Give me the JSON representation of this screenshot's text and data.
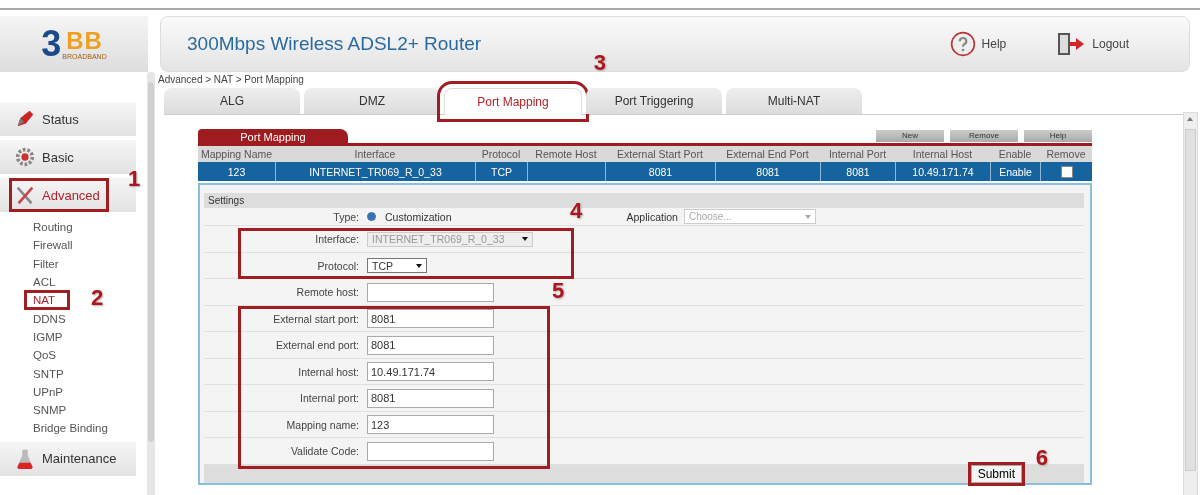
{
  "logo": {
    "digit": "3",
    "letters": "BB",
    "tagline": "BROADBAND"
  },
  "header": {
    "title": "300Mbps Wireless ADSL2+ Router",
    "actions": [
      {
        "label": "Help",
        "kind": "help"
      },
      {
        "label": "Logout",
        "kind": "logout"
      }
    ]
  },
  "sidebar": {
    "sections": [
      {
        "label": "Status",
        "kind": "status",
        "selected": false
      },
      {
        "label": "Basic",
        "kind": "basic",
        "selected": false
      },
      {
        "label": "Advanced",
        "kind": "advanced",
        "selected": true,
        "annotation": "1",
        "children": [
          {
            "label": "Routing",
            "selected": false
          },
          {
            "label": "Firewall",
            "selected": false
          },
          {
            "label": "Filter",
            "selected": false
          },
          {
            "label": "ACL",
            "selected": false
          },
          {
            "label": "NAT",
            "selected": true,
            "annotation": "2"
          },
          {
            "label": "DDNS",
            "selected": false
          },
          {
            "label": "IGMP",
            "selected": false
          },
          {
            "label": "QoS",
            "selected": false
          },
          {
            "label": "SNTP",
            "selected": false
          },
          {
            "label": "UPnP",
            "selected": false
          },
          {
            "label": "SNMP",
            "selected": false
          },
          {
            "label": "Bridge Binding",
            "selected": false
          }
        ]
      },
      {
        "label": "Maintenance",
        "kind": "maintenance",
        "selected": false
      }
    ]
  },
  "breadcrumb": "Advanced > NAT > Port Mapping",
  "tabs": [
    {
      "label": "ALG",
      "selected": false
    },
    {
      "label": "DMZ",
      "selected": false
    },
    {
      "label": "Port Mapping",
      "selected": true,
      "annotation": "3"
    },
    {
      "label": "Port Triggering",
      "selected": false
    },
    {
      "label": "Multi-NAT",
      "selected": false
    }
  ],
  "panel": {
    "title": "Port Mapping",
    "buttons": [
      "New",
      "Remove",
      "Help"
    ],
    "table": {
      "columns": [
        "Mapping Name",
        "Interface",
        "Protocol",
        "Remote Host",
        "External Start Port",
        "External End Port",
        "Internal Port",
        "Internal Host",
        "Enable",
        "Remove"
      ],
      "rows": [
        {
          "selected": true,
          "cells": [
            "123",
            "INTERNET_TR069_R_0_33",
            "TCP",
            "",
            "8081",
            "8081",
            "8081",
            "10.49.171.74",
            "Enable"
          ],
          "remove_checked": false
        }
      ]
    }
  },
  "settings": {
    "title": "Settings",
    "type": {
      "label": "Type:",
      "option": "Customization",
      "selected": true
    },
    "application": {
      "label": "Application",
      "placeholder": "Choose..."
    },
    "groups": [
      {
        "annotation": "4",
        "rows": [
          {
            "label": "Interface:",
            "kind": "select",
            "value": "INTERNET_TR069_R_0_33",
            "disabled": true
          },
          {
            "label": "Protocol:",
            "kind": "select",
            "value": "TCP",
            "disabled": false
          }
        ]
      },
      {
        "rows": [
          {
            "label": "Remote host:",
            "kind": "input"
          }
        ]
      },
      {
        "annotation": "5",
        "rows": [
          {
            "label": "External start port:",
            "kind": "input",
            "value": "8081"
          },
          {
            "label": "External end port:",
            "kind": "input",
            "value": "8081"
          },
          {
            "label": "Internal host:",
            "kind": "input",
            "value": "10.49.171.74"
          },
          {
            "label": "Internal port:",
            "kind": "input",
            "value": "8081"
          },
          {
            "label": "Mapping name:",
            "kind": "input",
            "value": "123"
          },
          {
            "label": "Validate Code:",
            "kind": "input"
          }
        ]
      }
    ],
    "submit": {
      "label": "Submit",
      "annotation": "6"
    }
  }
}
